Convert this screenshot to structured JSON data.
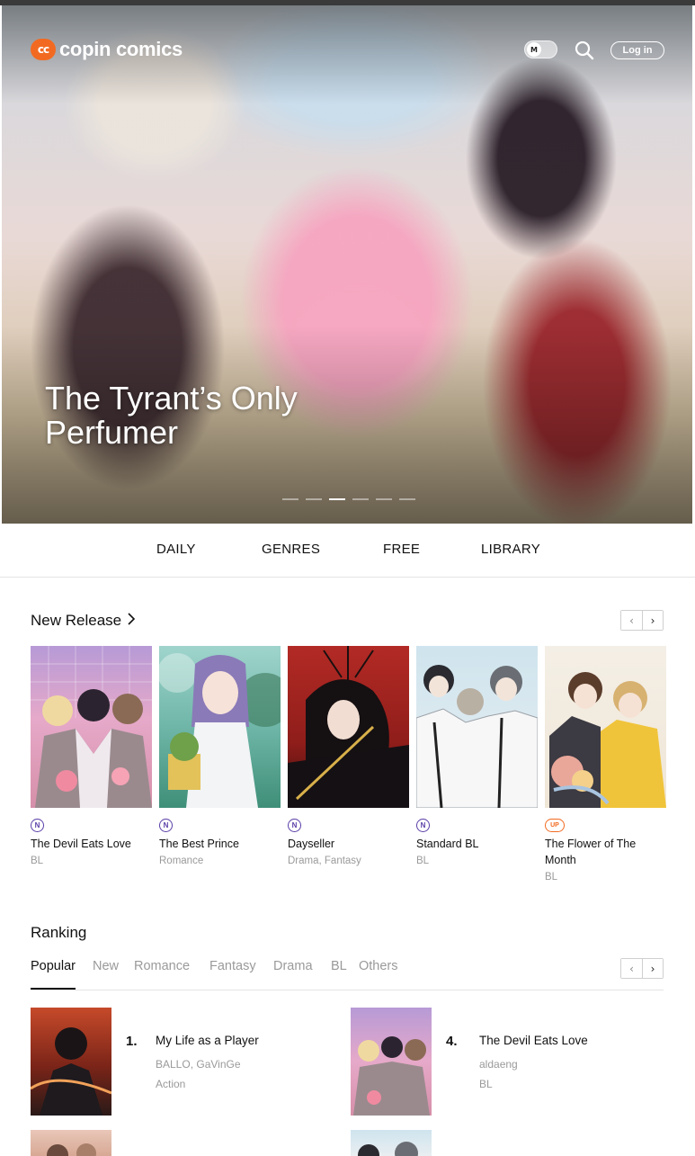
{
  "header": {
    "logo_mark": "cc",
    "logo_text": "copin comics",
    "mode_toggle_label": "M",
    "login_label": "Log in"
  },
  "hero": {
    "title": "The Tyrant’s Only Perfumer",
    "slide_count": 6,
    "active_slide": 3
  },
  "nav": {
    "items": [
      "DAILY",
      "GENRES",
      "FREE",
      "LIBRARY"
    ]
  },
  "new_release": {
    "title": "New Release",
    "items": [
      {
        "badge": "N",
        "title": "The Devil Eats Love",
        "genre": "BL"
      },
      {
        "badge": "N",
        "title": "The Best Prince",
        "genre": "Romance"
      },
      {
        "badge": "N",
        "title": "Dayseller",
        "genre": "Drama, Fantasy"
      },
      {
        "badge": "N",
        "title": "Standard BL",
        "genre": "BL"
      },
      {
        "badge": "UP",
        "title": "The Flower of The Month",
        "genre": "BL"
      }
    ]
  },
  "ranking": {
    "title": "Ranking",
    "tabs": [
      "Popular",
      "New",
      "Romance",
      "Fantasy",
      "Drama",
      "BL",
      "Others"
    ],
    "active_tab": "Popular",
    "items": [
      {
        "rank": "1.",
        "title": "My Life as a Player",
        "author": "BALLO, GaVinGe",
        "genre": "Action"
      },
      {
        "rank": "4.",
        "title": "The Devil Eats Love",
        "author": "aldaeng",
        "genre": "BL"
      }
    ]
  },
  "colors": {
    "brand": "#f26a21",
    "badge_new": "#5a3ea8",
    "muted_text": "#9a9a9a"
  }
}
